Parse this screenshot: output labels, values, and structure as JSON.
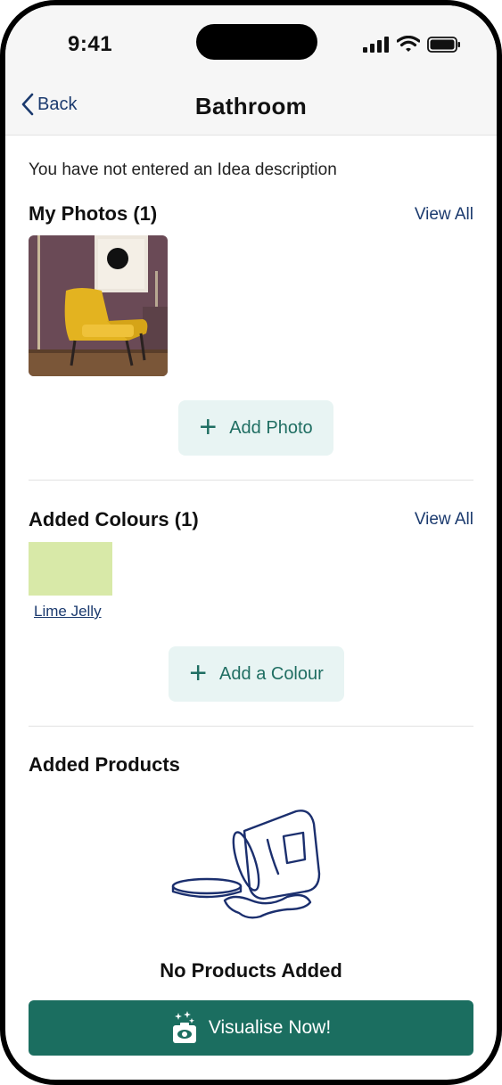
{
  "status_bar": {
    "time": "9:41",
    "icons": [
      "signal-icon",
      "wifi-icon",
      "battery-icon"
    ]
  },
  "nav": {
    "back_label": "Back",
    "title": "Bathroom"
  },
  "description": "You have not entered an Idea description",
  "photos": {
    "title": "My Photos (1)",
    "view_all": "View All",
    "add_label": "Add Photo"
  },
  "colours": {
    "title": "Added Colours (1)",
    "view_all": "View All",
    "items": [
      {
        "name": "Lime Jelly",
        "hex": "#d8e9a8"
      }
    ],
    "add_label": "Add a Colour"
  },
  "products": {
    "title": "Added Products",
    "empty_text": "No Products Added"
  },
  "cta": {
    "label": "Visualise Now!"
  },
  "colors": {
    "primary_green": "#1b6e60",
    "link_blue": "#1b3a6e",
    "button_tint": "#e8f4f3"
  }
}
